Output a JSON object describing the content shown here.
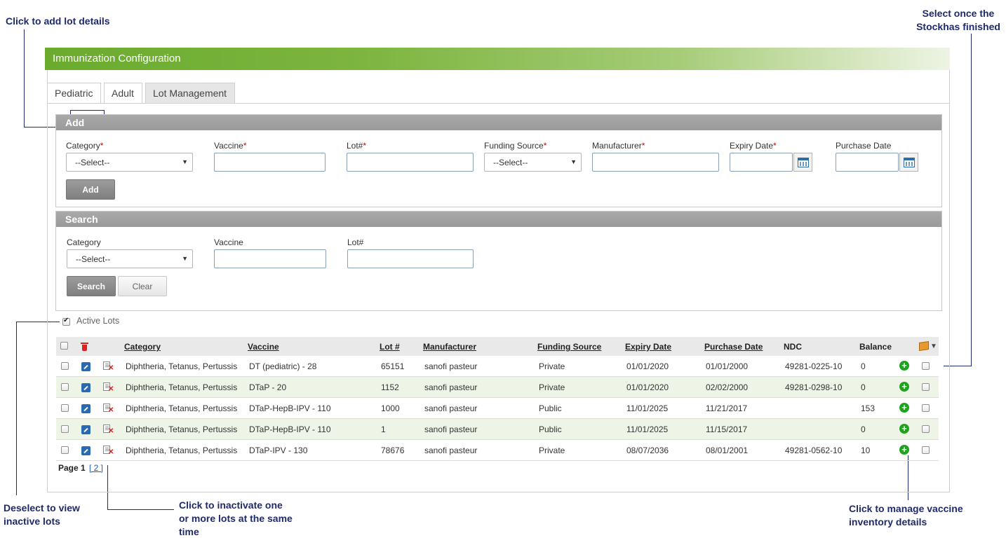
{
  "annotations": {
    "add_lot": "Click to add lot details",
    "select_stock_line1": "Select once the",
    "select_stock_line2": "Stockhas finished",
    "deselect_line1": "Deselect to view",
    "deselect_line2": "inactive lots",
    "inactivate_line1": "Click to inactivate one",
    "inactivate_line2": "or more lots at the same",
    "inactivate_line3": "time",
    "manage_line1": "Click to manage vaccine",
    "manage_line2": "inventory details"
  },
  "header": {
    "title": "Immunization Configuration"
  },
  "tabs": [
    {
      "label": "Pediatric",
      "active": false
    },
    {
      "label": "Adult",
      "active": false
    },
    {
      "label": "Lot Management",
      "active": true
    }
  ],
  "add_panel": {
    "title": "Add",
    "fields": {
      "category": {
        "label": "Category",
        "value": "--Select--"
      },
      "vaccine": {
        "label": "Vaccine",
        "value": ""
      },
      "lot": {
        "label": "Lot#",
        "value": ""
      },
      "funding_source": {
        "label": "Funding Source",
        "value": "--Select--"
      },
      "manufacturer": {
        "label": "Manufacturer",
        "value": ""
      },
      "expiry_date": {
        "label": "Expiry Date",
        "value": ""
      },
      "purchase_date": {
        "label": "Purchase Date",
        "value": ""
      }
    },
    "required_mark": "*",
    "add_button": "Add"
  },
  "search_panel": {
    "title": "Search",
    "fields": {
      "category": {
        "label": "Category",
        "value": "--Select--"
      },
      "vaccine": {
        "label": "Vaccine",
        "value": ""
      },
      "lot": {
        "label": "Lot#",
        "value": ""
      }
    },
    "search_button": "Search",
    "clear_button": "Clear"
  },
  "active_lots": {
    "label": "Active Lots",
    "checked": true
  },
  "table": {
    "columns": {
      "category": "Category",
      "vaccine": "Vaccine",
      "lot": "Lot #",
      "manufacturer": "Manufacturer",
      "funding_source": "Funding Source",
      "expiry_date": "Expiry Date",
      "purchase_date": "Purchase Date",
      "ndc": "NDC",
      "balance": "Balance"
    },
    "rows": [
      {
        "category": "Diphtheria, Tetanus, Pertussis",
        "vaccine": "DT (pediatric) - 28",
        "lot": "65151",
        "manufacturer": "sanofi pasteur",
        "funding_source": "Private",
        "expiry_date": "01/01/2020",
        "purchase_date": "01/01/2000",
        "ndc": "49281-0225-10",
        "balance": "0"
      },
      {
        "category": "Diphtheria, Tetanus, Pertussis",
        "vaccine": "DTaP - 20",
        "lot": "1152",
        "manufacturer": "sanofi pasteur",
        "funding_source": "Private",
        "expiry_date": "01/01/2020",
        "purchase_date": "02/02/2000",
        "ndc": "49281-0298-10",
        "balance": "0"
      },
      {
        "category": "Diphtheria, Tetanus, Pertussis",
        "vaccine": "DTaP-HepB-IPV - 110",
        "lot": "1000",
        "manufacturer": "sanofi pasteur",
        "funding_source": "Public",
        "expiry_date": "11/01/2025",
        "purchase_date": "11/21/2017",
        "ndc": "",
        "balance": "153"
      },
      {
        "category": "Diphtheria, Tetanus, Pertussis",
        "vaccine": "DTaP-HepB-IPV - 110",
        "lot": "1",
        "manufacturer": "sanofi pasteur",
        "funding_source": "Public",
        "expiry_date": "11/01/2025",
        "purchase_date": "11/15/2017",
        "ndc": "",
        "balance": "0"
      },
      {
        "category": "Diphtheria, Tetanus, Pertussis",
        "vaccine": "DTaP-IPV - 130",
        "lot": "78676",
        "manufacturer": "sanofi pasteur",
        "funding_source": "Private",
        "expiry_date": "08/07/2036",
        "purchase_date": "08/01/2001",
        "ndc": "49281-0562-10",
        "balance": "10"
      }
    ]
  },
  "pagination": {
    "label": "Page",
    "current": "1",
    "next": "[ 2 ]"
  },
  "colors": {
    "header_green": "#6aab2e",
    "annotation": "#1f2a6b",
    "alt_row": "#eef5e6",
    "add_icon": "#1fa31f",
    "delete_icon": "#d22222"
  },
  "icons": [
    "edit-icon",
    "inactivate-icon",
    "add-inventory-icon",
    "trash-icon",
    "calendar-icon",
    "stock-box-icon"
  ]
}
